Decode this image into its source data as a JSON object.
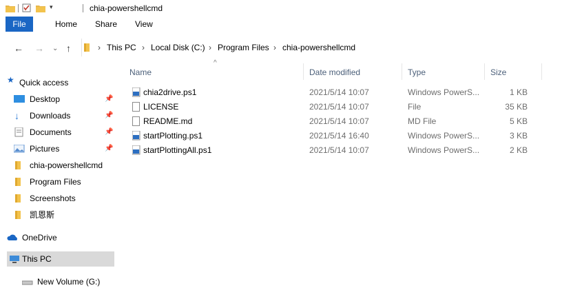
{
  "window": {
    "title": "chia-powershellcmd"
  },
  "ribbon": {
    "tabs": [
      "File",
      "Home",
      "Share",
      "View"
    ]
  },
  "address": {
    "crumbs": [
      "This PC",
      "Local Disk (C:)",
      "Program Files",
      "chia-powershellcmd"
    ]
  },
  "sidebar": {
    "quick_access": "Quick access",
    "items": [
      {
        "label": "Desktop",
        "icon": "desktop-icon",
        "pinned": true
      },
      {
        "label": "Downloads",
        "icon": "downloads-icon",
        "pinned": true
      },
      {
        "label": "Documents",
        "icon": "documents-icon",
        "pinned": true
      },
      {
        "label": "Pictures",
        "icon": "pictures-icon",
        "pinned": true
      },
      {
        "label": "chia-powershellcmd",
        "icon": "folder-icon",
        "pinned": false
      },
      {
        "label": "Program Files",
        "icon": "folder-icon",
        "pinned": false
      },
      {
        "label": "Screenshots",
        "icon": "folder-icon",
        "pinned": false
      },
      {
        "label": "凯恩斯",
        "icon": "folder-icon",
        "pinned": false
      }
    ],
    "onedrive": "OneDrive",
    "this_pc": "This PC",
    "new_volume": "New Volume (G:)"
  },
  "columns": {
    "name": "Name",
    "date": "Date modified",
    "type": "Type",
    "size": "Size"
  },
  "files": [
    {
      "name": "chia2drive.ps1",
      "date": "2021/5/14 10:07",
      "type": "Windows PowerS...",
      "size": "1 KB",
      "icon": "powershell-script-icon"
    },
    {
      "name": "LICENSE",
      "date": "2021/5/14 10:07",
      "type": "File",
      "size": "35 KB",
      "icon": "file-icon"
    },
    {
      "name": "README.md",
      "date": "2021/5/14 10:07",
      "type": "MD File",
      "size": "5 KB",
      "icon": "file-icon"
    },
    {
      "name": "startPlotting.ps1",
      "date": "2021/5/14 16:40",
      "type": "Windows PowerS...",
      "size": "3 KB",
      "icon": "powershell-script-icon"
    },
    {
      "name": "startPlottingAll.ps1",
      "date": "2021/5/14 10:07",
      "type": "Windows PowerS...",
      "size": "2 KB",
      "icon": "powershell-script-icon"
    }
  ],
  "colors": {
    "accent": "#1a66c4",
    "folder": "#f3c34d",
    "selected": "#d9d9d9"
  }
}
